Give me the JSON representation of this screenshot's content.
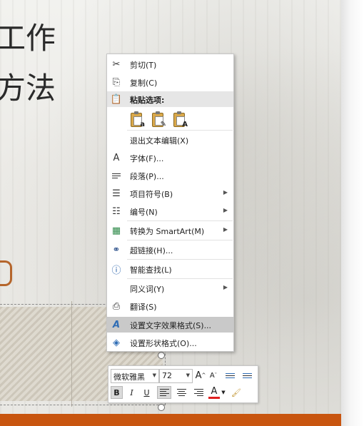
{
  "slide": {
    "title_line1": "工作",
    "title_line2": "方法",
    "title_visible_1": "工作",
    "title_visible_2": "方法"
  },
  "context_menu": {
    "items": [
      {
        "label": "剪切(T)",
        "icon": "scissors-icon"
      },
      {
        "label": "复制(C)",
        "icon": "copy-icon"
      },
      {
        "label": "粘贴选项:",
        "icon": "paste-icon"
      },
      {
        "label": "退出文本编辑(X)",
        "icon": ""
      },
      {
        "label": "字体(F)...",
        "icon": "font-icon"
      },
      {
        "label": "段落(P)...",
        "icon": "paragraph-icon"
      },
      {
        "label": "项目符号(B)",
        "icon": "bullets-icon",
        "submenu": true
      },
      {
        "label": "编号(N)",
        "icon": "numbering-icon",
        "submenu": true
      },
      {
        "label": "转换为 SmartArt(M)",
        "icon": "smartart-icon",
        "submenu": true
      },
      {
        "label": "超链接(H)...",
        "icon": "hyperlink-icon"
      },
      {
        "label": "智能查找(L)",
        "icon": "smart-lookup-icon"
      },
      {
        "label": "同义词(Y)",
        "icon": "",
        "submenu": true
      },
      {
        "label": "翻译(S)",
        "icon": "translate-icon"
      },
      {
        "label": "设置文字效果格式(S)...",
        "icon": "text-effects-icon",
        "highlighted": true
      },
      {
        "label": "设置形状格式(O)...",
        "icon": "shape-format-icon"
      }
    ],
    "paste_options": [
      {
        "tag": "a",
        "icon": "paste-keep-source-icon"
      },
      {
        "tag": "✎",
        "icon": "paste-picture-icon"
      },
      {
        "tag": "A",
        "icon": "paste-text-only-icon"
      }
    ]
  },
  "mini_toolbar": {
    "font": "微软雅黑",
    "size": "72",
    "grow": "A",
    "shrink": "A",
    "bold": "B",
    "italic": "I",
    "underline": "U",
    "font_color_letter": "A"
  },
  "colors": {
    "accent_bar": "#c8550f",
    "menu_highlight": "#c9c9c9",
    "font_color": "#e02020"
  }
}
